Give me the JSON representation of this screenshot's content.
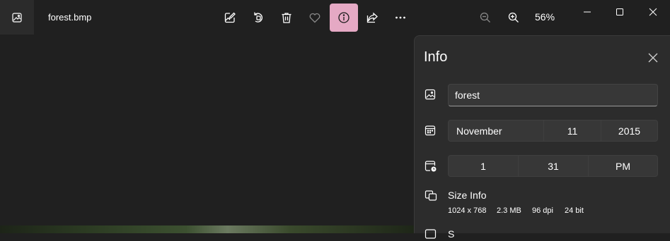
{
  "title_bar": {
    "file_name": "forest.bmp",
    "zoom_level": "56%"
  },
  "toolbar": {
    "buttons": [
      {
        "icon": "edit-image-icon"
      },
      {
        "icon": "rotate-icon"
      },
      {
        "icon": "delete-icon"
      },
      {
        "icon": "favorite-heart-icon"
      },
      {
        "icon": "info-icon",
        "active": true
      },
      {
        "icon": "share-icon"
      },
      {
        "icon": "more-options-icon"
      }
    ],
    "active_color": "#e5a9c4"
  },
  "info_panel": {
    "title": "Info",
    "name_value": "forest",
    "date": {
      "month": "November",
      "day": "11",
      "year": "2015"
    },
    "time": {
      "hour": "1",
      "minute": "31",
      "period": "PM"
    },
    "size_info": {
      "label": "Size Info",
      "dimensions": "1024 x 768",
      "file_size": "2.3 MB",
      "dpi": "96 dpi",
      "bit_depth": "24 bit"
    },
    "next_section_label": "S"
  }
}
